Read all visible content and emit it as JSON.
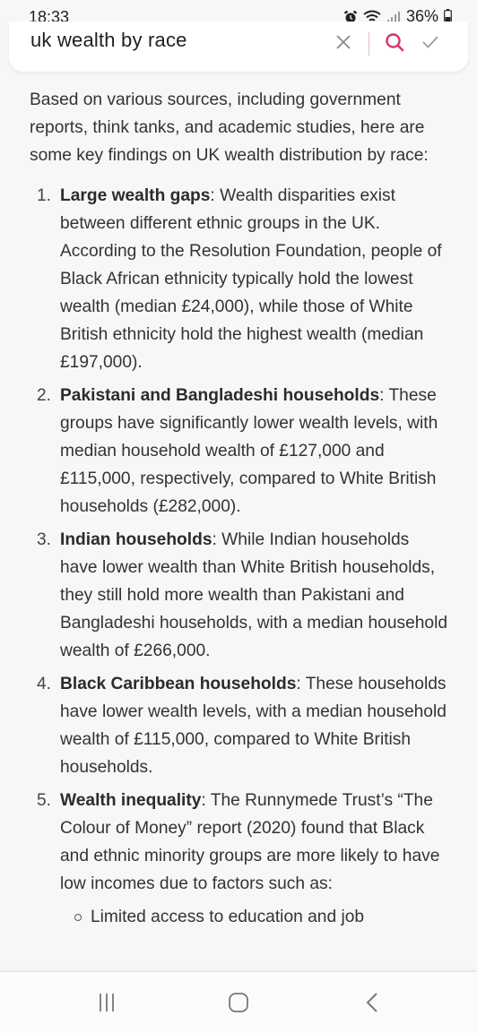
{
  "status_bar": {
    "time": "18:33",
    "battery": "36%"
  },
  "search": {
    "query": "uk wealth by race"
  },
  "content": {
    "intro": "Based on various sources, including government reports, think tanks, and academic studies, here are some key findings on UK wealth distribution by race:",
    "findings": [
      {
        "number": "1.",
        "lead": "Large wealth gaps",
        "text": ": Wealth disparities exist between different ethnic groups in the UK. According to the Resolution Foundation, people of Black African ethnicity typically hold the lowest wealth (median £24,000), while those of White British ethnicity hold the highest wealth (median £197,000)."
      },
      {
        "number": "2.",
        "lead": "Pakistani and Bangladeshi households",
        "text": ": These groups have significantly lower wealth levels, with median household wealth of £127,000 and £115,000, respectively, compared to White British households (£282,000)."
      },
      {
        "number": "3.",
        "lead": "Indian households",
        "text": ": While Indian households have lower wealth than White British households, they still hold more wealth than Pakistani and Bangladeshi households, with a median household wealth of £266,000."
      },
      {
        "number": "4.",
        "lead": "Black Caribbean households",
        "text": ": These households have lower wealth levels, with a median household wealth of £115,000, compared to White British households."
      },
      {
        "number": "5.",
        "lead": "Wealth inequality",
        "text": ": The Runnymede Trust’s “The Colour of Money” report (2020) found that Black and ethnic minority groups are more likely to have low incomes due to factors such as:",
        "subitems": [
          "Limited access to education and job"
        ]
      }
    ]
  },
  "nav": {
    "recents_icon": "recent-apps-icon",
    "home_icon": "home-icon",
    "back_icon": "back-icon"
  },
  "colors": {
    "search_icon": "#d6336c",
    "clear_icon": "#8a8a8a",
    "check_icon": "#9a9a9a",
    "divider": "#e6b8c6"
  }
}
